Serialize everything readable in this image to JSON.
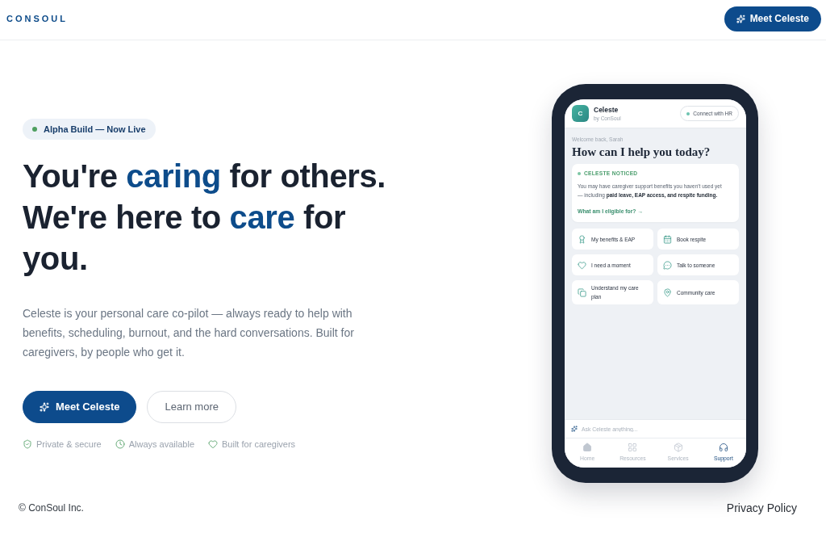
{
  "header": {
    "logo": "CONSOUL",
    "cta": "Meet Celeste"
  },
  "hero": {
    "badge": "Alpha Build — Now Live",
    "headline": [
      {
        "text": "You're ",
        "highlight": false
      },
      {
        "text": "caring",
        "highlight": true
      },
      {
        "text": " for others. We're here to ",
        "highlight": false
      },
      {
        "text": "care",
        "highlight": true
      },
      {
        "text": " for you.",
        "highlight": false
      }
    ],
    "description": "Celeste is your personal care co-pilot — always ready to help with benefits, scheduling, burnout, and the hard conversations. Built for caregivers, by people who get it.",
    "buttons": [
      {
        "label": "Meet Celeste",
        "kind": "primary"
      },
      {
        "label": "Learn more",
        "kind": "secondary"
      }
    ],
    "features": [
      "Private & secure",
      "Always available",
      "Built for caregivers"
    ]
  },
  "phone": {
    "assistant": {
      "avatar": "C",
      "name": "Celeste",
      "subtitle": "by ConSoul"
    },
    "connect_button": "Connect with HR",
    "greeting": "Welcome back, Sarah",
    "title": "How can I help you today?",
    "notice": {
      "label": "CELESTE NOTICED",
      "text": "You may have caregiver support benefits you haven't used yet — including **paid leave, EAP access, and respite funding.**",
      "link": "What am I eligible for? →"
    },
    "actions": [
      "My benefits & EAP",
      "Book respite",
      "I need a moment",
      "Talk to someone",
      "Understand my care plan",
      "Community care"
    ],
    "input": {
      "placeholder": "Ask Celeste anything..."
    },
    "nav": [
      {
        "label": "Home",
        "selected": false
      },
      {
        "label": "Resources",
        "selected": false
      },
      {
        "label": "Services",
        "selected": false
      },
      {
        "label": "Support",
        "selected": true
      }
    ]
  },
  "footer": {
    "copyright": "© ConSoul Inc.",
    "links": [
      "Privacy Policy"
    ]
  }
}
